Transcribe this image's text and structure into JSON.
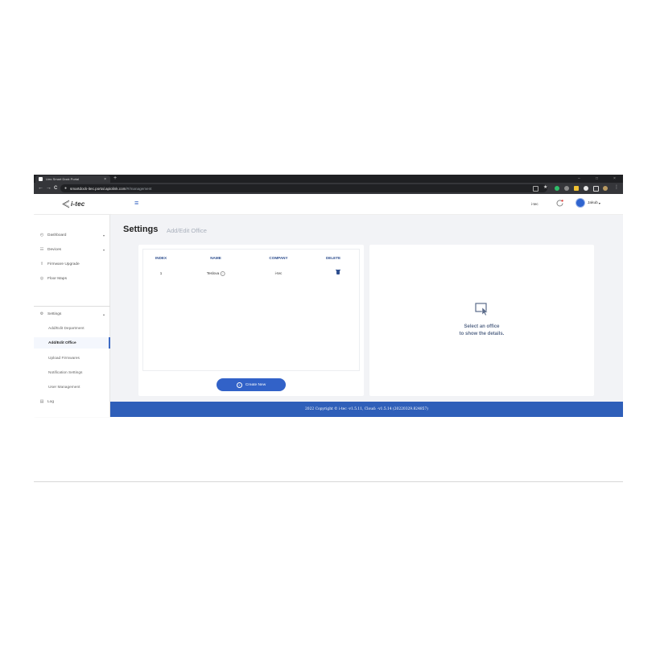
{
  "browser": {
    "tab_title": "i-tec Smart Dock Portal",
    "tab_close": "×",
    "new_tab": "+",
    "url_host": "smartdock-itec.portal.apiolink.com",
    "url_path": "/#/management",
    "nav_back": "←",
    "nav_forward": "→",
    "nav_reload": "C",
    "minimize": "–",
    "maximize": "□",
    "close": "×"
  },
  "app": {
    "logo_text": "i-tec",
    "org_name": "i-tec",
    "user_name": "Jakub"
  },
  "sidebar": {
    "items": [
      {
        "label": "Dashboard",
        "icon": "dashboard-icon",
        "caret": "▾"
      },
      {
        "label": "Devices",
        "icon": "devices-icon",
        "caret": "▾"
      },
      {
        "label": "Firmware Upgrade",
        "icon": "firmware-icon"
      },
      {
        "label": "Floor Maps",
        "icon": "map-icon"
      }
    ],
    "settings": {
      "label": "Settings",
      "icon": "gear-icon",
      "caret": "▴"
    },
    "settings_items": [
      "Add/Edit Department",
      "Add/Edit Office",
      "Upload Firmwares",
      "Notification Settings",
      "User Management"
    ],
    "log": {
      "label": "Log",
      "icon": "log-icon"
    }
  },
  "page": {
    "title": "Settings",
    "crumb": "Add/Edit Office"
  },
  "table": {
    "headers": [
      "INDEX",
      "NAME",
      "COMPANY",
      "DELETE"
    ],
    "rows": [
      {
        "index": "1",
        "name": "Teslova",
        "company": "i-tec"
      }
    ]
  },
  "create_button": "Create New",
  "details": {
    "line1": "Select an office",
    "line2": "to show the details."
  },
  "footer": "2022 Copyright © i-tec -v1.5.11, Cloud: -v1.5.14 (20220329.824857)",
  "colors": {
    "accent": "#3262c8",
    "footer": "#2f5fb9",
    "header_text": "#2f4f8f"
  }
}
